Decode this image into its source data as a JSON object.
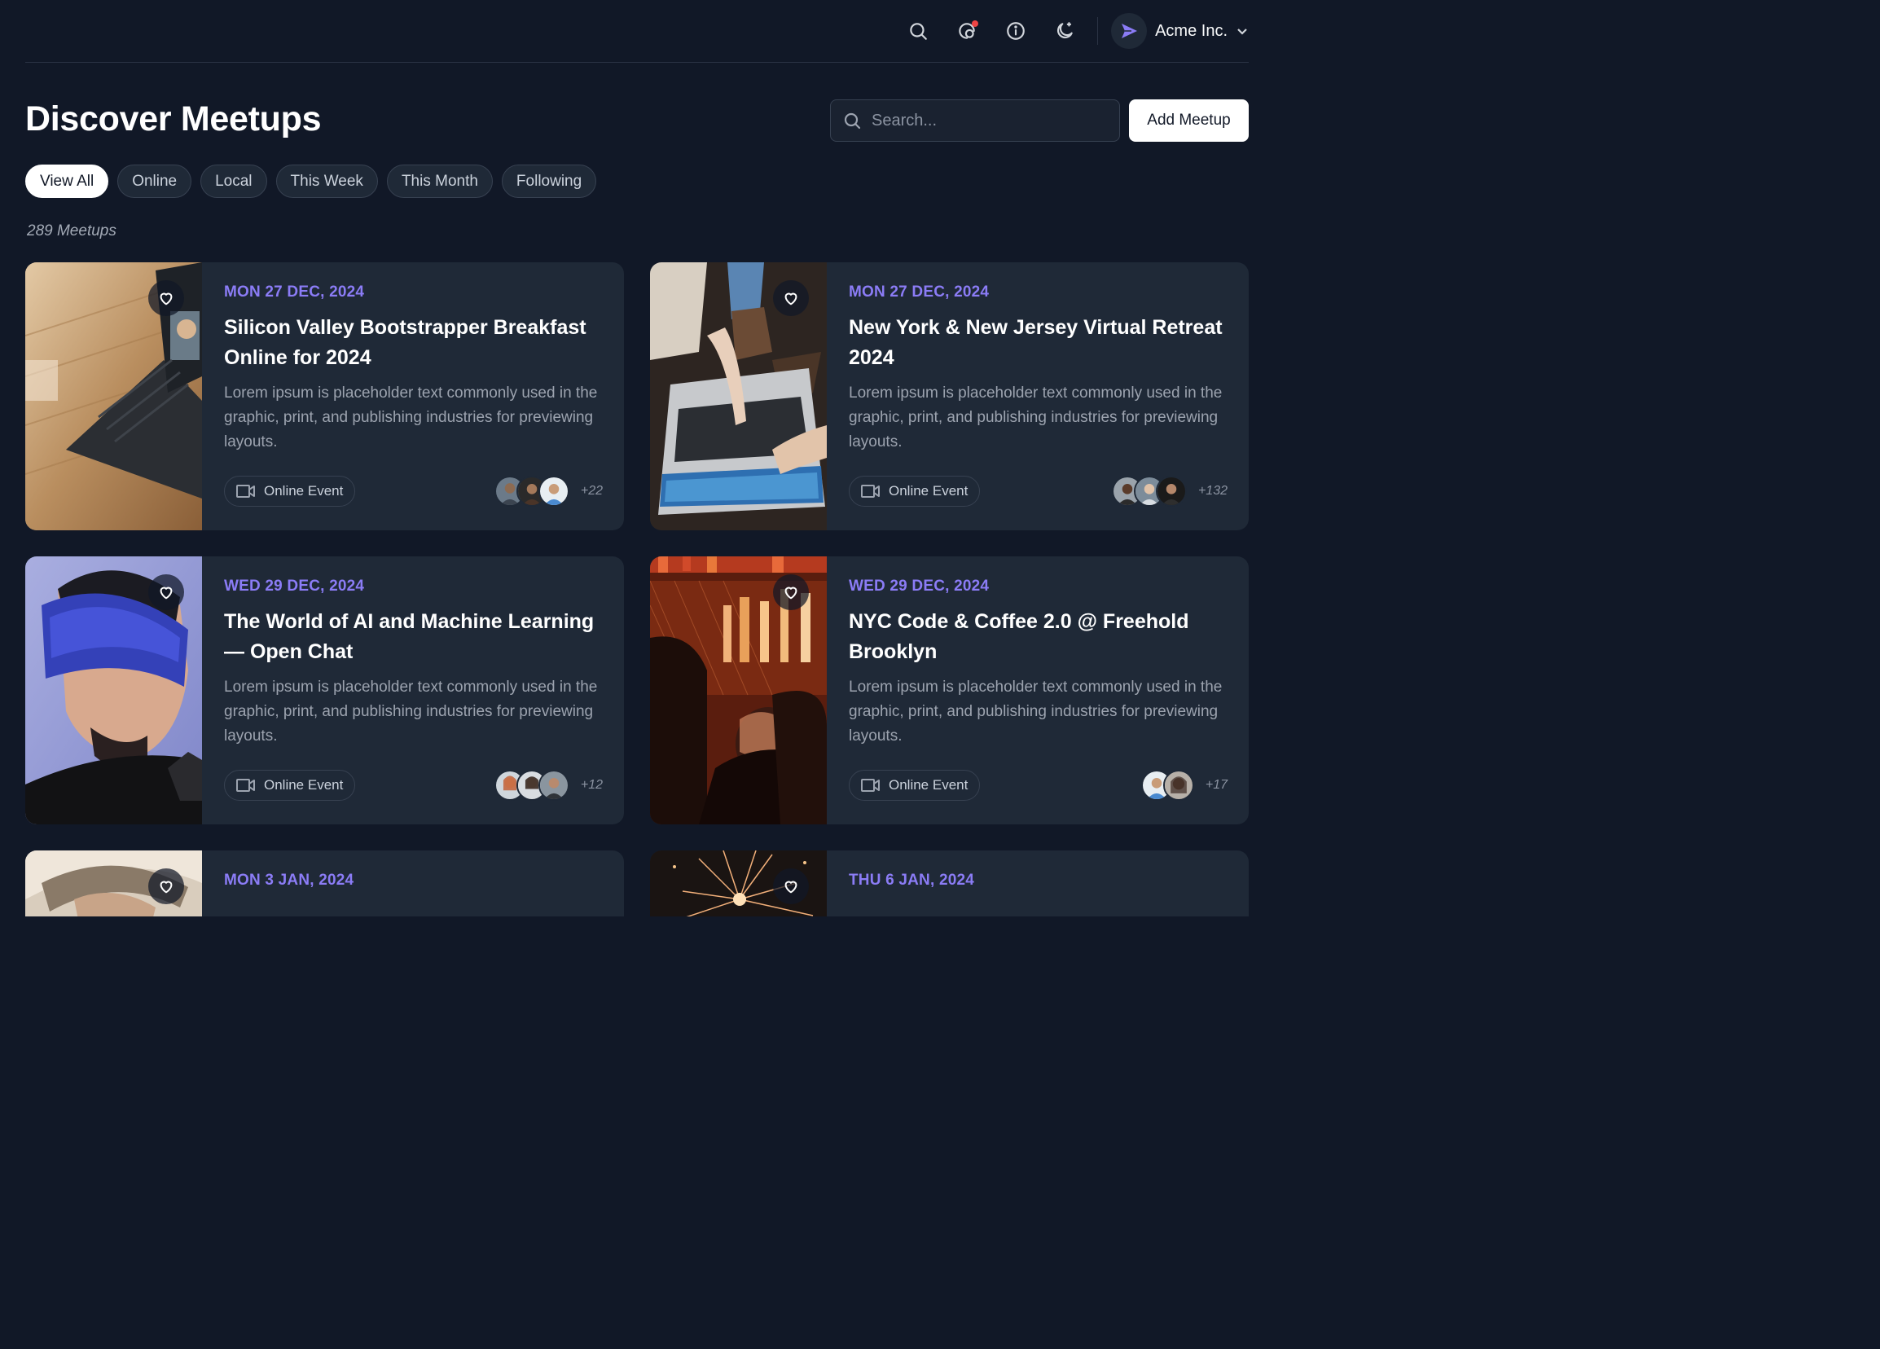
{
  "topbar": {
    "icons": [
      "search-icon",
      "notifications-icon",
      "info-icon",
      "dark-mode-icon"
    ],
    "account": {
      "name": "Acme Inc.",
      "logo": "paper-plane-logo",
      "accent": "#8b7cf6"
    }
  },
  "header": {
    "title": "Discover Meetups",
    "search_placeholder": "Search...",
    "add_button": "Add Meetup"
  },
  "filters": {
    "items": [
      "View All",
      "Online",
      "Local",
      "This Week",
      "This Month",
      "Following"
    ],
    "active": "View All"
  },
  "meetup_count": "289 Meetups",
  "colors": {
    "accent": "#8b7cf6",
    "background": "#111827",
    "card": "#1f2937"
  },
  "meetups": [
    {
      "date": "MON 27 DEC, 2024",
      "title": "Silicon Valley Bootstrapper Breakfast Online for 2024",
      "description": "Lorem ipsum is placeholder text commonly used in the graphic, print, and publishing industries for previewing layouts.",
      "badge": "Online Event",
      "extra_attendees": "+22",
      "image": "laptop-video-call-photo"
    },
    {
      "date": "MON 27 DEC, 2024",
      "title": "New York & New Jersey Virtual Retreat 2024",
      "description": "Lorem ipsum is placeholder text commonly used in the graphic, print, and publishing industries for previewing layouts.",
      "badge": "Online Event",
      "extra_attendees": "+132",
      "image": "hands-pointing-laptop-photo"
    },
    {
      "date": "WED 29 DEC, 2024",
      "title": "The World of AI and Machine Learning — Open Chat",
      "description": "Lorem ipsum is placeholder text commonly used in the graphic, print, and publishing industries for previewing layouts.",
      "badge": "Online Event",
      "extra_attendees": "+12",
      "image": "vr-headset-photo"
    },
    {
      "date": "WED 29 DEC, 2024",
      "title": "NYC Code & Coffee 2.0 @ Freehold Brooklyn",
      "description": "Lorem ipsum is placeholder text commonly used in the graphic, print, and publishing industries for previewing layouts.",
      "badge": "Online Event",
      "extra_attendees": "+17",
      "image": "bar-crowd-photo"
    },
    {
      "date": "MON 3 JAN, 2024",
      "title": "",
      "image": "person-hat-photo"
    },
    {
      "date": "THU 6 JAN, 2024",
      "title": "",
      "image": "sparkler-photo"
    }
  ]
}
